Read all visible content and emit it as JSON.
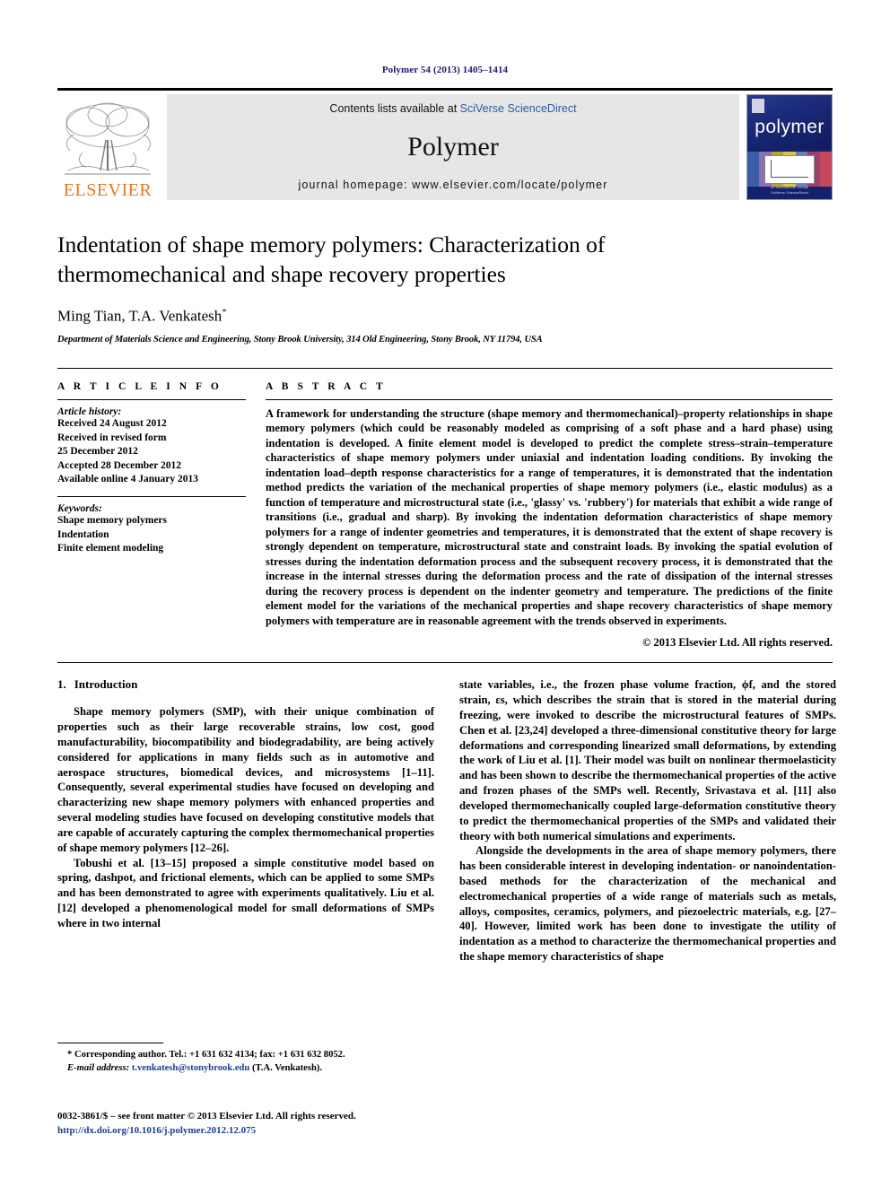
{
  "running_head": "Polymer 54 (2013) 1405–1414",
  "masthead": {
    "publisher_name": "ELSEVIER",
    "contents_prefix": "Contents lists available at ",
    "contents_link": "SciVerse ScienceDirect",
    "journal_name": "Polymer",
    "homepage": "journal homepage: www.elsevier.com/locate/polymer",
    "cover_word": "polymer",
    "cover_footer": "An International Journal\nSciVerse ScienceDirect"
  },
  "article": {
    "title": "Indentation of shape memory polymers: Characterization of thermomechanical and shape recovery properties",
    "authors": "Ming Tian, T.A. Venkatesh",
    "author_marker": "*",
    "affiliation": "Department of Materials Science and Engineering, Stony Brook University, 314 Old Engineering, Stony Brook, NY 11794, USA"
  },
  "info": {
    "heading": "A R T I C L E   I N F O",
    "history_label": "Article history:",
    "history": [
      "Received 24 August 2012",
      "Received in revised form",
      "25 December 2012",
      "Accepted 28 December 2012",
      "Available online 4 January 2013"
    ],
    "keywords_label": "Keywords:",
    "keywords": [
      "Shape memory polymers",
      "Indentation",
      "Finite element modeling"
    ]
  },
  "abstract": {
    "heading": "A B S T R A C T",
    "text": "A framework for understanding the structure (shape memory and thermomechanical)–property relationships in shape memory polymers (which could be reasonably modeled as comprising of a soft phase and a hard phase) using indentation is developed. A finite element model is developed to predict the complete stress–strain–temperature characteristics of shape memory polymers under uniaxial and indentation loading conditions. By invoking the indentation load–depth response characteristics for a range of temperatures, it is demonstrated that the indentation method predicts the variation of the mechanical properties of shape memory polymers (i.e., elastic modulus) as a function of temperature and microstructural state (i.e., 'glassy' vs. 'rubbery') for materials that exhibit a wide range of transitions (i.e., gradual and sharp). By invoking the indentation deformation characteristics of shape memory polymers for a range of indenter geometries and temperatures, it is demonstrated that the extent of shape recovery is strongly dependent on temperature, microstructural state and constraint loads. By invoking the spatial evolution of stresses during the indentation deformation process and the subsequent recovery process, it is demonstrated that the increase in the internal stresses during the deformation process and the rate of dissipation of the internal stresses during the recovery process is dependent on the indenter geometry and temperature. The predictions of the finite element model for the variations of the mechanical properties and shape recovery characteristics of shape memory polymers with temperature are in reasonable agreement with the trends observed in experiments.",
    "copyright": "© 2013 Elsevier Ltd. All rights reserved."
  },
  "body": {
    "section_number": "1.",
    "section_title": "Introduction",
    "left_paragraphs": [
      "Shape memory polymers (SMP), with their unique combination of properties such as their large recoverable strains, low cost, good manufacturability, biocompatibility and biodegradability, are being actively considered for applications in many fields such as in automotive and aerospace structures, biomedical devices, and microsystems [1–11]. Consequently, several experimental studies have focused on developing and characterizing new shape memory polymers with enhanced properties and several modeling studies have focused on developing constitutive models that are capable of accurately capturing the complex thermomechanical properties of shape memory polymers [12–26].",
      "Tobushi et al. [13–15] proposed a simple constitutive model based on spring, dashpot, and frictional elements, which can be applied to some SMPs and has been demonstrated to agree with experiments qualitatively. Liu et al. [12] developed a phenomenological model for small deformations of SMPs where in two internal"
    ],
    "right_paragraphs": [
      "state variables, i.e., the frozen phase volume fraction, ϕf, and the stored strain, εs, which describes the strain that is stored in the material during freezing, were invoked to describe the microstructural features of SMPs. Chen et al. [23,24] developed a three-dimensional constitutive theory for large deformations and corresponding linearized small deformations, by extending the work of Liu et al. [1]. Their model was built on nonlinear thermoelasticity and has been shown to describe the thermomechanical properties of the active and frozen phases of the SMPs well. Recently, Srivastava et al. [11] also developed thermomechanically coupled large-deformation constitutive theory to predict the thermomechanical properties of the SMPs and validated their theory with both numerical simulations and experiments.",
      "Alongside the developments in the area of shape memory polymers, there has been considerable interest in developing indentation- or nanoindentation-based methods for the characterization of the mechanical and electromechanical properties of a wide range of materials such as metals, alloys, composites, ceramics, polymers, and piezoelectric materials, e.g. [27–40]. However, limited work has been done to investigate the utility of indentation as a method to characterize the thermomechanical properties and the shape memory characteristics of shape"
    ]
  },
  "footnote": {
    "marker": "*",
    "corresponding": "Corresponding author. Tel.: +1 631 632 4134; fax: +1 631 632 8052.",
    "email_label": "E-mail address:",
    "email": "t.venkatesh@stonybrook.edu",
    "email_suffix": "(T.A. Venkatesh)."
  },
  "footer": {
    "issn_line": "0032-3861/$ – see front matter © 2013 Elsevier Ltd. All rights reserved.",
    "doi": "http://dx.doi.org/10.1016/j.polymer.2012.12.075"
  },
  "colors": {
    "link_blue": "#2b59a8",
    "cite_blue": "#1b3f8f",
    "runhead_navy": "#1b1b6f",
    "elsevier_orange": "#E87722",
    "cover_navy": "#14216b",
    "band_grey": "#e6e6e6"
  }
}
